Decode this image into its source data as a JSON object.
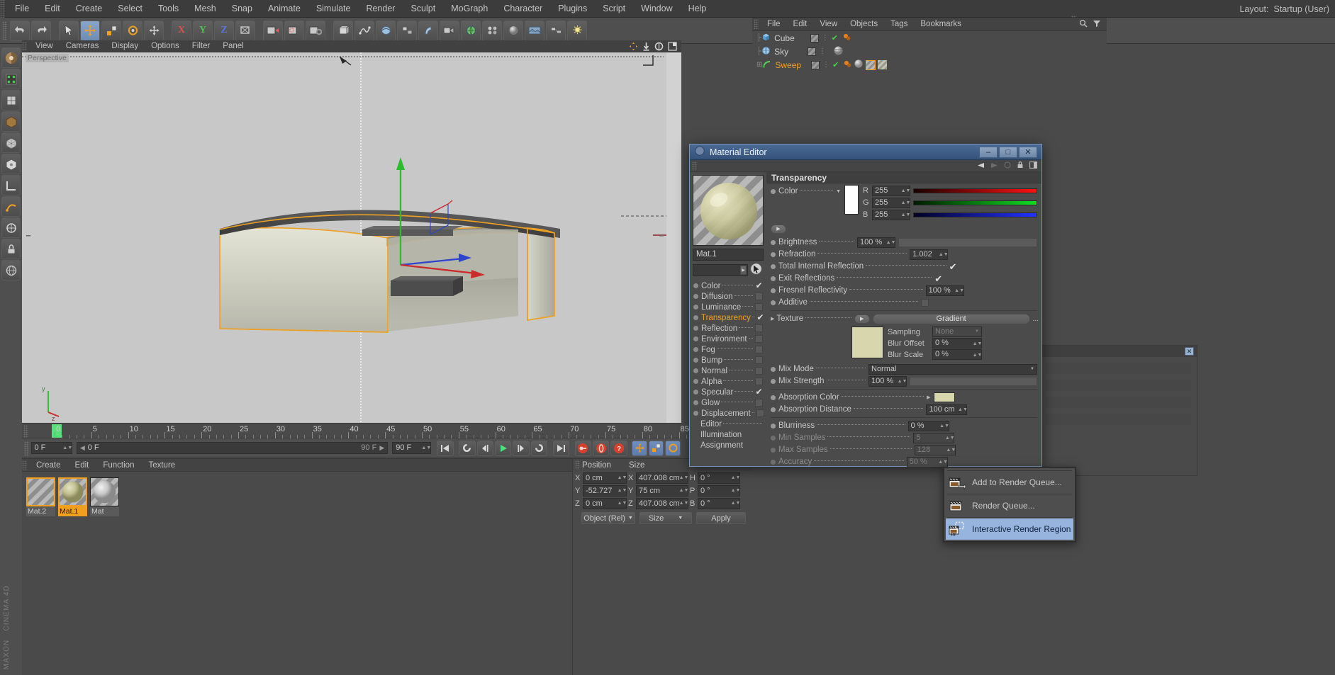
{
  "app": {
    "title": "CINEMA 4D",
    "brand_line1": "MAXON",
    "brand_line2": "CINEMA 4D"
  },
  "menubar": {
    "items": [
      "File",
      "Edit",
      "Create",
      "Select",
      "Tools",
      "Mesh",
      "Snap",
      "Animate",
      "Simulate",
      "Render",
      "Sculpt",
      "MoGraph",
      "Character",
      "Plugins",
      "Script",
      "Window",
      "Help"
    ],
    "layout_label": "Layout:",
    "layout_value": "Startup (User)"
  },
  "viewport": {
    "menu": [
      "View",
      "Cameras",
      "Display",
      "Options",
      "Filter",
      "Panel"
    ],
    "label": "Perspective"
  },
  "timeline": {
    "ticks": [
      "0",
      "5",
      "10",
      "15",
      "20",
      "25",
      "30",
      "35",
      "40",
      "45",
      "50",
      "55",
      "60",
      "65",
      "70",
      "75",
      "80",
      "85"
    ],
    "current_frame": "0 F",
    "preview_start": "0 F",
    "preview_end": "90 F",
    "end_frame": "90 F"
  },
  "material_manager": {
    "menu": [
      "Create",
      "Edit",
      "Function",
      "Texture"
    ],
    "materials": [
      {
        "name": "Mat.2",
        "selected": false,
        "kind": "checker"
      },
      {
        "name": "Mat.1",
        "selected": true,
        "kind": "olive"
      },
      {
        "name": "Mat",
        "selected": false,
        "kind": "grey"
      }
    ]
  },
  "coordinates": {
    "headers": [
      "Position",
      "Size"
    ],
    "rows": [
      {
        "axis": "X",
        "position": "0 cm",
        "size_axis": "X",
        "size": "407.008 cm",
        "rot_axis": "H",
        "rot": "0 °"
      },
      {
        "axis": "Y",
        "position": "-52.727 cm",
        "size_axis": "Y",
        "size": "75 cm",
        "rot_axis": "P",
        "rot": "0 °"
      },
      {
        "axis": "Z",
        "position": "0 cm",
        "size_axis": "Z",
        "size": "407.008 cm",
        "rot_axis": "B",
        "rot": "0 °"
      }
    ],
    "mode_dropdown": "Object (Rel)",
    "size_dropdown": "Size",
    "apply_label": "Apply"
  },
  "object_manager": {
    "menu": [
      "File",
      "Edit",
      "View",
      "Objects",
      "Tags",
      "Bookmarks"
    ],
    "objects": [
      {
        "name": "Cube",
        "selected": false,
        "icon": "cube-icon"
      },
      {
        "name": "Sky",
        "selected": false,
        "icon": "sky-icon"
      },
      {
        "name": "Sweep",
        "selected": true,
        "icon": "sweep-icon"
      }
    ]
  },
  "material_editor": {
    "window_title": "Material Editor",
    "window_buttons": {
      "minimize": "–",
      "maximize": "□",
      "close": "✕"
    },
    "material_name": "Mat.1",
    "channels": [
      {
        "label": "Color",
        "checked": true,
        "active": false
      },
      {
        "label": "Diffusion",
        "checked": false,
        "active": false
      },
      {
        "label": "Luminance",
        "checked": false,
        "active": false
      },
      {
        "label": "Transparency",
        "checked": true,
        "active": true
      },
      {
        "label": "Reflection",
        "checked": false,
        "active": false
      },
      {
        "label": "Environment",
        "checked": false,
        "active": false
      },
      {
        "label": "Fog",
        "checked": false,
        "active": false
      },
      {
        "label": "Bump",
        "checked": false,
        "active": false
      },
      {
        "label": "Normal",
        "checked": false,
        "active": false
      },
      {
        "label": "Alpha",
        "checked": false,
        "active": false
      },
      {
        "label": "Specular",
        "checked": true,
        "active": false
      },
      {
        "label": "Glow",
        "checked": false,
        "active": false
      },
      {
        "label": "Displacement",
        "checked": false,
        "active": false
      }
    ],
    "channels_plain": [
      "Editor",
      "Illumination",
      "Assignment"
    ],
    "section_title": "Transparency",
    "color": {
      "label": "Color",
      "swatch_hex": "#ffffff",
      "channels": [
        {
          "name": "R",
          "value": "255"
        },
        {
          "name": "G",
          "value": "255"
        },
        {
          "name": "B",
          "value": "255"
        }
      ]
    },
    "params": [
      {
        "label": "Brightness",
        "value": "100 %",
        "type": "field_slider"
      },
      {
        "label": "Refraction",
        "value": "1.002",
        "type": "field"
      },
      {
        "label": "Total Internal Reflection",
        "value": "✔",
        "type": "check"
      },
      {
        "label": "Exit Reflections",
        "value": "✔",
        "type": "check"
      },
      {
        "label": "Fresnel Reflectivity",
        "value": "100 %",
        "type": "field"
      },
      {
        "label": "Additive",
        "value": "",
        "type": "checkbox"
      }
    ],
    "texture": {
      "label": "Texture",
      "value": "Gradient",
      "ellipsis": "...",
      "swatch_hex": "#d8d6ad",
      "sampling_label": "Sampling",
      "sampling_value": "None",
      "blur_offset_label": "Blur Offset",
      "blur_offset_value": "0 %",
      "blur_scale_label": "Blur Scale",
      "blur_scale_value": "0 %"
    },
    "mix": [
      {
        "label": "Mix Mode",
        "value": "Normal"
      },
      {
        "label": "Mix Strength",
        "value": "100 %"
      }
    ],
    "absorption": [
      {
        "label": "Absorption Color",
        "value": "",
        "swatch_hex": "#d8d6ad"
      },
      {
        "label": "Absorption Distance",
        "value": "100 cm"
      }
    ],
    "blur": [
      {
        "label": "Blurriness",
        "value": "0 %",
        "enabled": true
      },
      {
        "label": "Min Samples",
        "value": "5",
        "enabled": false
      },
      {
        "label": "Max Samples",
        "value": "128",
        "enabled": false
      },
      {
        "label": "Accuracy",
        "value": "50 %",
        "enabled": false
      }
    ]
  },
  "context_menu": {
    "items": [
      {
        "label": "Add to Render Queue...",
        "selected": false,
        "icon": "render-queue-add-icon"
      },
      {
        "label": "Render Queue...",
        "selected": false,
        "icon": "render-queue-icon"
      },
      {
        "label": "Interactive Render Region",
        "selected": true,
        "icon": "irr-icon"
      }
    ]
  },
  "colors": {
    "accent_orange": "#f0a020",
    "titlebar_blue": "#3b5a85",
    "selection_blue": "#96b4de",
    "panel_bg": "#4a4a4a",
    "toolbar_bg": "#4f4f4f",
    "viewport_bg": "#c8c8c8",
    "red_channel": "#cc1111",
    "green_channel": "#11aa22",
    "blue_channel": "#2233dd"
  }
}
